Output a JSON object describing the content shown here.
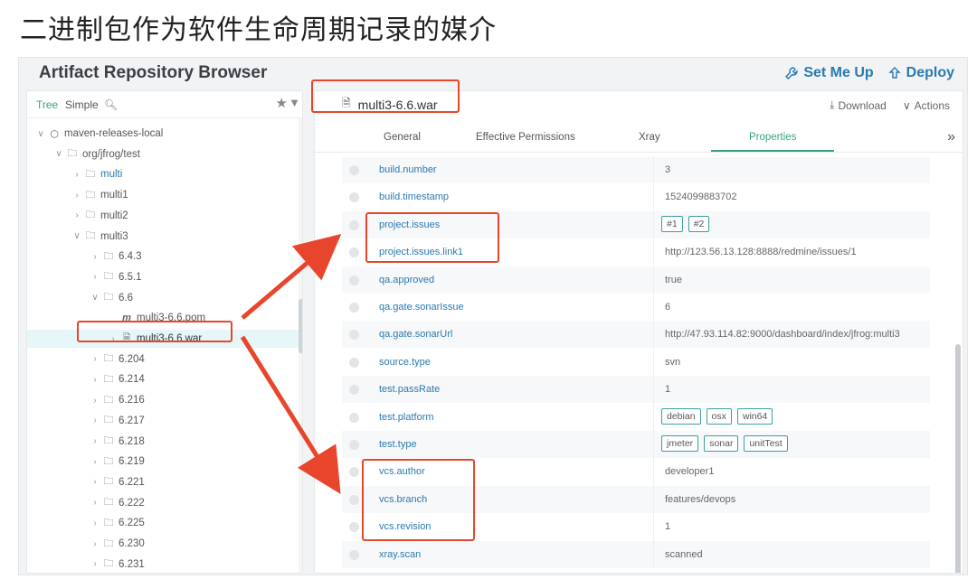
{
  "slide": {
    "title": "二进制包作为软件生命周期记录的媒介"
  },
  "app": {
    "title": "Artifact Repository Browser",
    "setmeup": "Set Me Up",
    "deploy": "Deploy"
  },
  "tree": {
    "tab_tree": "Tree",
    "tab_simple": "Simple",
    "items": [
      {
        "label": "maven-releases-local",
        "depth": 0,
        "chev": "v",
        "icon": "box"
      },
      {
        "label": "org/jfrog/test",
        "depth": 1,
        "chev": "v",
        "icon": "folder"
      },
      {
        "label": "multi",
        "depth": 2,
        "chev": ">",
        "icon": "folder",
        "highlight": true
      },
      {
        "label": "multi1",
        "depth": 2,
        "chev": ">",
        "icon": "folder"
      },
      {
        "label": "multi2",
        "depth": 2,
        "chev": ">",
        "icon": "folder"
      },
      {
        "label": "multi3",
        "depth": 2,
        "chev": "v",
        "icon": "folder"
      },
      {
        "label": "6.4.3",
        "depth": 3,
        "chev": ">",
        "icon": "folder"
      },
      {
        "label": "6.5.1",
        "depth": 3,
        "chev": ">",
        "icon": "folder"
      },
      {
        "label": "6.6",
        "depth": 3,
        "chev": "v",
        "icon": "folder"
      },
      {
        "label": "multi3-6.6.pom",
        "depth": 4,
        "chev": "",
        "icon": "m"
      },
      {
        "label": "multi3-6.6.war",
        "depth": 4,
        "chev": ">",
        "icon": "jar",
        "selected": true
      },
      {
        "label": "6.204",
        "depth": 3,
        "chev": ">",
        "icon": "folder"
      },
      {
        "label": "6.214",
        "depth": 3,
        "chev": ">",
        "icon": "folder"
      },
      {
        "label": "6.216",
        "depth": 3,
        "chev": ">",
        "icon": "folder"
      },
      {
        "label": "6.217",
        "depth": 3,
        "chev": ">",
        "icon": "folder"
      },
      {
        "label": "6.218",
        "depth": 3,
        "chev": ">",
        "icon": "folder"
      },
      {
        "label": "6.219",
        "depth": 3,
        "chev": ">",
        "icon": "folder"
      },
      {
        "label": "6.221",
        "depth": 3,
        "chev": ">",
        "icon": "folder"
      },
      {
        "label": "6.222",
        "depth": 3,
        "chev": ">",
        "icon": "folder"
      },
      {
        "label": "6.225",
        "depth": 3,
        "chev": ">",
        "icon": "folder"
      },
      {
        "label": "6.230",
        "depth": 3,
        "chev": ">",
        "icon": "folder"
      },
      {
        "label": "6.231",
        "depth": 3,
        "chev": ">",
        "icon": "folder"
      }
    ]
  },
  "detail": {
    "file_name": "multi3-6.6.war",
    "download": "Download",
    "actions": "Actions",
    "tabs": [
      "General",
      "Effective Permissions",
      "Xray",
      "Properties"
    ],
    "active_tab": "Properties",
    "properties": [
      {
        "key": "build.number",
        "value": "3"
      },
      {
        "key": "build.timestamp",
        "value": "1524099883702"
      },
      {
        "key": "project.issues",
        "chips": [
          "#1",
          "#2"
        ]
      },
      {
        "key": "project.issues.link1",
        "value": "http://123.56.13.128:8888/redmine/issues/1"
      },
      {
        "key": "qa.approved",
        "value": "true"
      },
      {
        "key": "qa.gate.sonarIssue",
        "value": "6"
      },
      {
        "key": "qa.gate.sonarUrl",
        "value": "http://47.93.114.82:9000/dashboard/index/jfrog:multi3"
      },
      {
        "key": "source.type",
        "value": "svn"
      },
      {
        "key": "test.passRate",
        "value": "1"
      },
      {
        "key": "test.platform",
        "chips": [
          "debian",
          "osx",
          "win64"
        ]
      },
      {
        "key": "test.type",
        "chips": [
          "jmeter",
          "sonar",
          "unitTest"
        ]
      },
      {
        "key": "vcs.author",
        "value": "developer1"
      },
      {
        "key": "vcs.branch",
        "value": "features/devops"
      },
      {
        "key": "vcs.revision",
        "value": "1"
      },
      {
        "key": "xray.scan",
        "value": "scanned"
      }
    ]
  },
  "colors": {
    "accent_green": "#3aa57a",
    "link_blue": "#2a7ab0",
    "annotation_red": "#e8462c"
  }
}
